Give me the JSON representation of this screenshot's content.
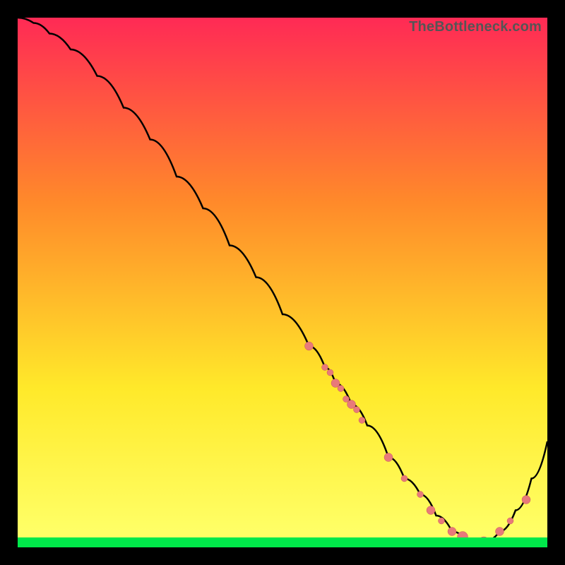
{
  "watermark": "TheBottleneck.com",
  "colors": {
    "background": "#000000",
    "gradient_top": "#ff2a55",
    "gradient_mid1": "#ff8a2a",
    "gradient_mid2": "#ffe92a",
    "gradient_bottom": "#ffff66",
    "green_band": "#00e84a",
    "curve": "#000000",
    "marker_fill": "#e87a7a",
    "marker_stroke": "#c95a5a"
  },
  "chart_data": {
    "type": "line",
    "title": "",
    "xlabel": "",
    "ylabel": "",
    "xlim": [
      0,
      100
    ],
    "ylim": [
      0,
      100
    ],
    "grid": false,
    "legend": null,
    "series": [
      {
        "name": "bottleneck-curve",
        "x": [
          0,
          3,
          6,
          10,
          15,
          20,
          25,
          30,
          35,
          40,
          45,
          50,
          55,
          58,
          60,
          63,
          66,
          70,
          73,
          76,
          79,
          82,
          85,
          88,
          91,
          94,
          97,
          100
        ],
        "values": [
          100,
          99,
          97,
          94,
          89,
          83,
          77,
          70,
          64,
          57,
          51,
          44,
          38,
          34,
          31,
          27,
          23,
          17,
          13,
          10,
          6,
          3,
          1,
          1,
          3,
          7,
          13,
          20
        ]
      }
    ],
    "markers": {
      "name": "data-points",
      "x": [
        55,
        58,
        59,
        60,
        61,
        62,
        63,
        64,
        65,
        70,
        73,
        76,
        78,
        80,
        82,
        84,
        85,
        86,
        88,
        91,
        93,
        96
      ],
      "values": [
        38,
        34,
        33,
        31,
        30,
        28,
        27,
        26,
        24,
        17,
        13,
        10,
        7,
        5,
        3,
        2,
        1,
        1,
        1,
        3,
        5,
        9
      ],
      "radius_base": 4.5
    }
  }
}
